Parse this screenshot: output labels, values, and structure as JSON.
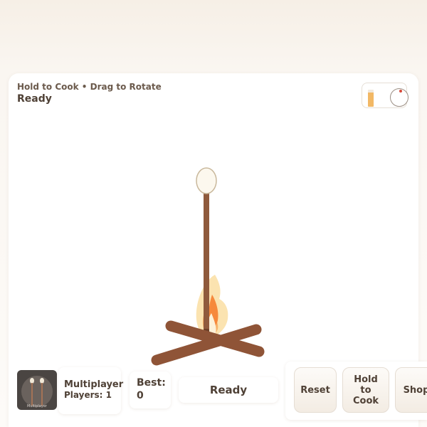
{
  "header": {
    "hint": "Hold to Cook • Drag to Rotate",
    "status": "Ready"
  },
  "gauges": {
    "heat_level": 0.85,
    "heat_color": "#f2b865",
    "rotation_indicator": "red-dot"
  },
  "scene": {
    "objects": [
      "marshmallow",
      "roasting-stick",
      "campfire-flame",
      "crossed-logs"
    ],
    "colors": {
      "marshmallow": "#fcf8ee",
      "stick": "#8f5a3c",
      "logs": "#8f5437",
      "flame_outer": "#fbe3b0",
      "flame_mid": "#f7b36a",
      "flame_inner": "#f6893c"
    }
  },
  "multiplayer": {
    "thumbnail_label": "Multiplayer",
    "title": "Multiplayer",
    "players": "Players: 1"
  },
  "score": {
    "best_label": "Best:",
    "best_value": "0"
  },
  "state_label": "Ready",
  "buttons": {
    "reset": "Reset",
    "cook": "Hold to Cook",
    "shop": "Shop"
  }
}
